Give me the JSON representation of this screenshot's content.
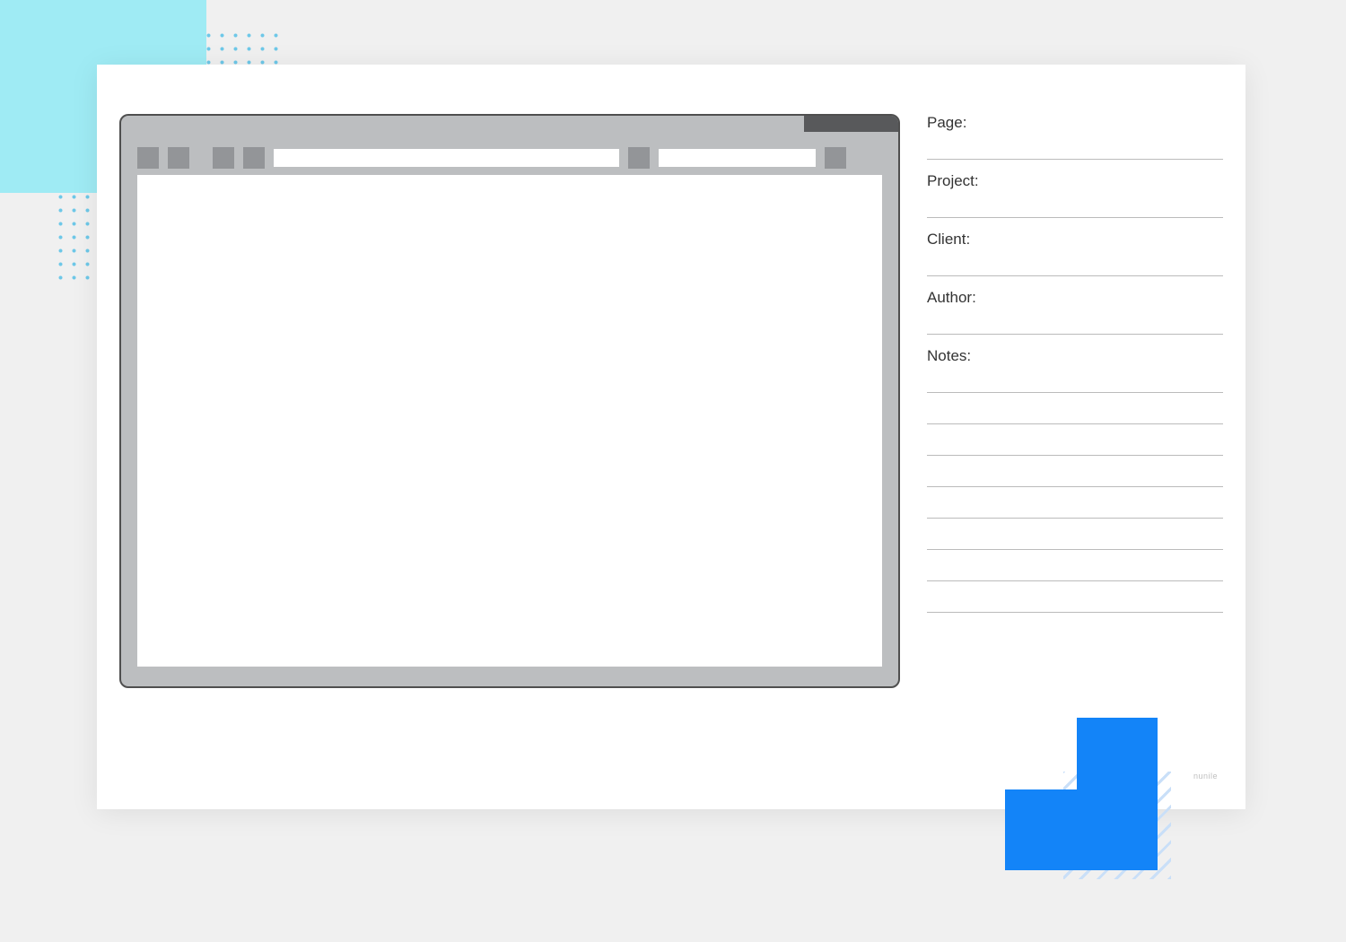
{
  "meta": {
    "page_label": "Page:",
    "project_label": "Project:",
    "client_label": "Client:",
    "author_label": "Author:",
    "notes_label": "Notes:"
  },
  "watermark": "nunile"
}
